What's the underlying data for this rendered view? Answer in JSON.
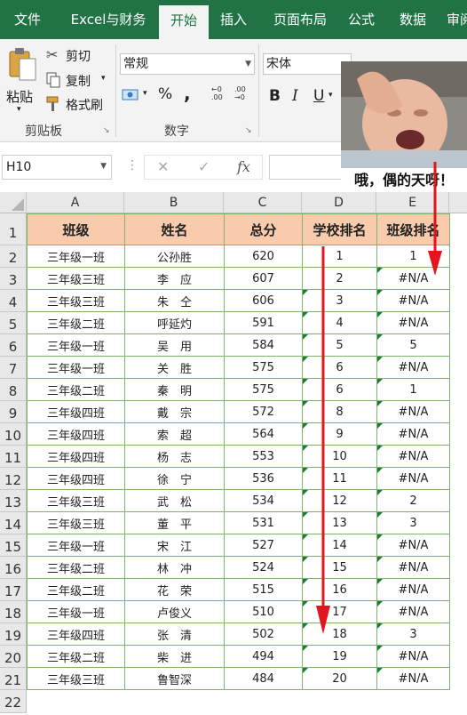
{
  "tabs": [
    "文件",
    "Excel与财务",
    "开始",
    "插入",
    "页面布局",
    "公式",
    "数据",
    "审阅"
  ],
  "active_tab": "开始",
  "clipboard": {
    "paste": "粘贴",
    "cut": "剪切",
    "copy": "复制",
    "format_painter": "格式刷",
    "group_label": "剪贴板"
  },
  "number": {
    "format": "常规",
    "percent": "%",
    "comma": ",",
    "group_label": "数字"
  },
  "font": {
    "name": "宋体",
    "bold": "B",
    "italic": "I",
    "underline": "U"
  },
  "formula_bar": {
    "name_box": "H10",
    "fx": "fx",
    "value": ""
  },
  "meme_caption": "哦，偶的天呀！",
  "colors": {
    "ribbon_green": "#217346",
    "header_fill": "#f8cbad",
    "border_green": "#7cb56b",
    "arrow_red": "#e4161d"
  },
  "columns": [
    "A",
    "B",
    "C",
    "D",
    "E"
  ],
  "row_numbers": [
    "1",
    "2",
    "3",
    "4",
    "5",
    "6",
    "7",
    "8",
    "9",
    "10",
    "11",
    "12",
    "13",
    "14",
    "15",
    "16",
    "17",
    "18",
    "19",
    "20",
    "21",
    "22"
  ],
  "table": {
    "headers": [
      "班级",
      "姓名",
      "总分",
      "学校排名",
      "班级排名"
    ],
    "rows": [
      [
        "三年级一班",
        "公孙胜",
        "620",
        "1",
        "1"
      ],
      [
        "三年级三班",
        "李　应",
        "607",
        "2",
        "#N/A"
      ],
      [
        "三年级三班",
        "朱　仝",
        "606",
        "3",
        "#N/A"
      ],
      [
        "三年级二班",
        "呼延灼",
        "591",
        "4",
        "#N/A"
      ],
      [
        "三年级一班",
        "吴　用",
        "584",
        "5",
        "5"
      ],
      [
        "三年级一班",
        "关　胜",
        "575",
        "6",
        "#N/A"
      ],
      [
        "三年级二班",
        "秦　明",
        "575",
        "6",
        "1"
      ],
      [
        "三年级四班",
        "戴　宗",
        "572",
        "8",
        "#N/A"
      ],
      [
        "三年级四班",
        "索　超",
        "564",
        "9",
        "#N/A"
      ],
      [
        "三年级四班",
        "杨　志",
        "553",
        "10",
        "#N/A"
      ],
      [
        "三年级四班",
        "徐　宁",
        "536",
        "11",
        "#N/A"
      ],
      [
        "三年级三班",
        "武　松",
        "534",
        "12",
        "2"
      ],
      [
        "三年级三班",
        "董　平",
        "531",
        "13",
        "3"
      ],
      [
        "三年级一班",
        "宋　江",
        "527",
        "14",
        "#N/A"
      ],
      [
        "三年级二班",
        "林　冲",
        "524",
        "15",
        "#N/A"
      ],
      [
        "三年级二班",
        "花　荣",
        "515",
        "16",
        "#N/A"
      ],
      [
        "三年级一班",
        "卢俊义",
        "510",
        "17",
        "#N/A"
      ],
      [
        "三年级四班",
        "张　清",
        "502",
        "18",
        "3"
      ],
      [
        "三年级二班",
        "柴　进",
        "494",
        "19",
        "#N/A"
      ],
      [
        "三年级三班",
        "鲁智深",
        "484",
        "20",
        "#N/A"
      ]
    ],
    "error_flag_rows_D": [
      2,
      3,
      4,
      5,
      6,
      7,
      8,
      9,
      10,
      11,
      12,
      13,
      14,
      15,
      16,
      17,
      18,
      19
    ],
    "error_flag_rows_E": [
      1,
      2,
      3,
      4,
      5,
      6,
      7,
      8,
      9,
      10,
      11,
      12,
      13,
      14,
      15,
      16,
      17,
      18,
      19
    ]
  }
}
